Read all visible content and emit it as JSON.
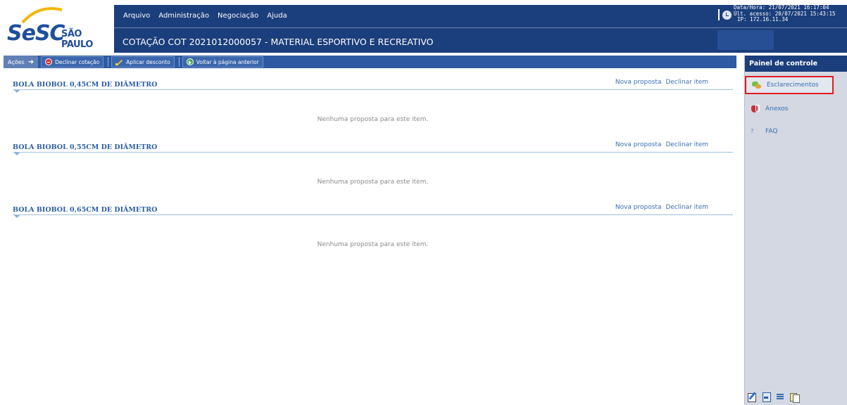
{
  "brand": {
    "logo_word": "SeSC",
    "logo_sub": "SÃO PAULO",
    "colors": {
      "primary": "#1b3e7c",
      "accent": "#2b5da3",
      "highlight_border": "#e11b22"
    }
  },
  "header": {
    "menu": [
      {
        "label": "Arquivo"
      },
      {
        "label": "Administração"
      },
      {
        "label": "Negociação"
      },
      {
        "label": "Ajuda"
      }
    ],
    "title": "COTAÇÃO COT 2021012000057 - MATERIAL ESPORTIVO E RECREATIVO",
    "session": {
      "datetime": "Data/Hora: 21/07/2021 16:17:04",
      "last_access": "Últ. acesso: 20/07/2021 15:43:15",
      "ip": "IP: 172.16.11.34"
    }
  },
  "toolbar": {
    "actions_label": "Ações",
    "buttons": [
      {
        "label": "Declinar cotação",
        "icon": "decline-icon"
      },
      {
        "label": "Aplicar desconto",
        "icon": "discount-icon"
      },
      {
        "label": "Voltar à página anterior",
        "icon": "back-icon"
      }
    ]
  },
  "items": [
    {
      "title": "BOLA BIOBOL 0,45CM DE DIÂMETRO",
      "new_proposal": "Nova proposta",
      "decline": "Declinar item",
      "empty_text": "Nenhuma proposta para este item."
    },
    {
      "title": "BOLA BIOBOL 0,55CM DE DIÂMETRO",
      "new_proposal": "Nova proposta",
      "decline": "Declinar item",
      "empty_text": "Nenhuma proposta para este item."
    },
    {
      "title": "BOLA BIOBOL 0,65CM DE DIÂMETRO",
      "new_proposal": "Nova proposta",
      "decline": "Declinar item",
      "empty_text": "Nenhuma proposta para este item."
    }
  ],
  "control_panel": {
    "title": "Painel de controle",
    "items": [
      {
        "label": "Esclarecimentos",
        "icon": "chat-icon",
        "highlighted": true
      },
      {
        "label": "Anexos",
        "icon": "attachment-icon",
        "highlighted": false
      },
      {
        "label": "FAQ",
        "icon": "faq-icon",
        "highlighted": false
      }
    ],
    "bottom_icons": [
      "edit-icon",
      "calculator-icon",
      "list-icon",
      "documents-icon"
    ]
  }
}
